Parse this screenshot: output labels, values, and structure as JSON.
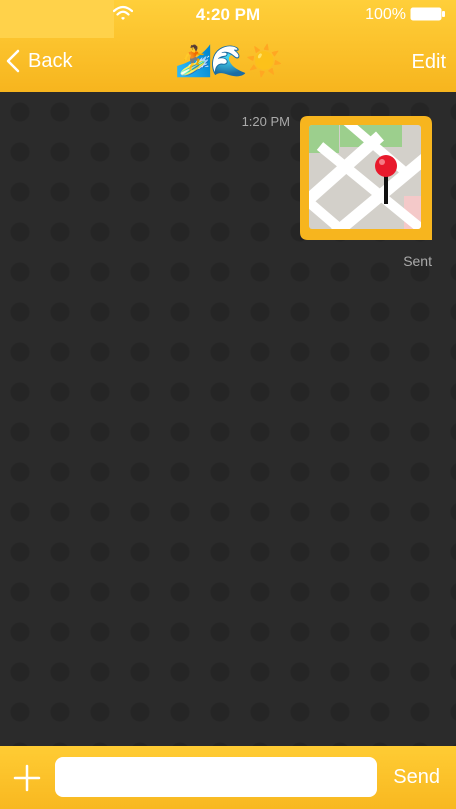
{
  "status_bar": {
    "time": "4:20 PM",
    "battery_percent": "100%",
    "icons": [
      "wifi-icon",
      "battery-icon"
    ]
  },
  "nav": {
    "back_label": "Back",
    "title": "🏄🌊☀️",
    "edit_label": "Edit"
  },
  "messages": [
    {
      "time": "1:20 PM",
      "type": "location",
      "icon": "map-pin-icon",
      "status": "Sent"
    }
  ],
  "input": {
    "value": "",
    "send_label": "Send",
    "add_icon": "plus-icon"
  },
  "colors": {
    "accent": "#f9bd25",
    "background": "#2a2a2a",
    "bubble_border": "#f7b51e",
    "pin": "#e8192c"
  }
}
